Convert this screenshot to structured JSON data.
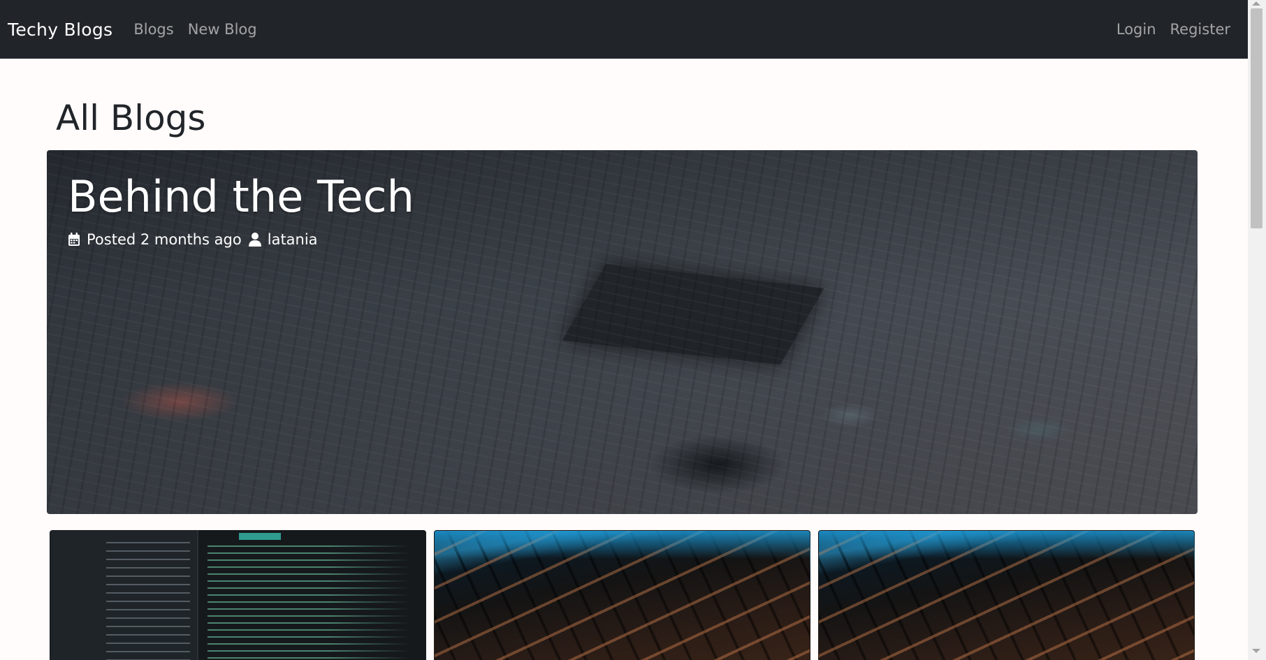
{
  "nav": {
    "brand": "Techy Blogs",
    "left_links": [
      "Blogs",
      "New Blog"
    ],
    "right_links": [
      "Login",
      "Register"
    ]
  },
  "main": {
    "page_title": "All Blogs",
    "featured": {
      "title": "Behind the Tech",
      "posted": "Posted 2 months ago",
      "author": "latania",
      "icons": [
        "calendar-icon",
        "user-icon"
      ]
    },
    "cards": [
      {
        "image": "code-editor-image"
      },
      {
        "image": "keyboard-image"
      },
      {
        "image": "keyboard-image"
      }
    ]
  },
  "colors": {
    "navbar": "#212529",
    "background": "#fffcfb",
    "text_dark": "#212529",
    "nav_link": "rgba(255,255,255,0.58)"
  }
}
